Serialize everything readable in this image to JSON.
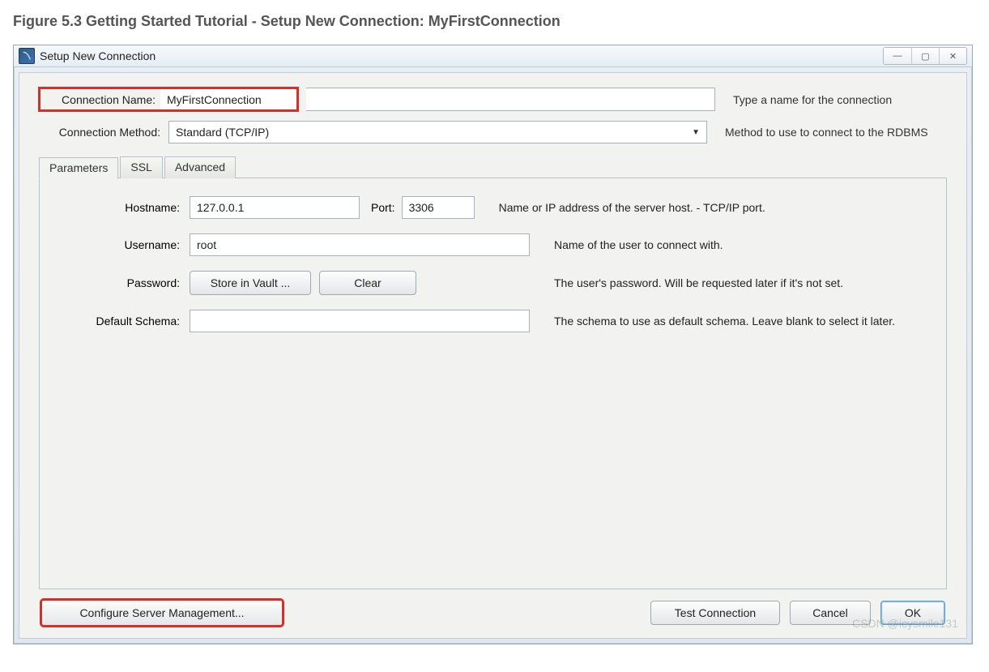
{
  "figure_title": "Figure 5.3 Getting Started Tutorial - Setup New Connection: MyFirstConnection",
  "window": {
    "title": "Setup New Connection",
    "minimize": "—",
    "maximize": "▢",
    "close": "✕"
  },
  "form": {
    "connection_name_label": "Connection Name:",
    "connection_name_value": "MyFirstConnection",
    "connection_name_help": "Type a name for the connection",
    "connection_method_label": "Connection Method:",
    "connection_method_value": "Standard (TCP/IP)",
    "connection_method_help": "Method to use to connect to the RDBMS"
  },
  "tabs": {
    "parameters": "Parameters",
    "ssl": "SSL",
    "advanced": "Advanced"
  },
  "params": {
    "hostname_label": "Hostname:",
    "hostname_value": "127.0.0.1",
    "port_label": "Port:",
    "port_value": "3306",
    "hostname_help": "Name or IP address of the server host. - TCP/IP port.",
    "username_label": "Username:",
    "username_value": "root",
    "username_help": "Name of the user to connect with.",
    "password_label": "Password:",
    "store_vault_btn": "Store in Vault ...",
    "clear_btn": "Clear",
    "password_help": "The user's password. Will be requested later if it's not set.",
    "default_schema_label": "Default Schema:",
    "default_schema_value": "",
    "default_schema_help": "The schema to use as default schema. Leave blank to select it later."
  },
  "footer": {
    "configure_btn": "Configure Server Management...",
    "test_btn": "Test Connection",
    "cancel_btn": "Cancel",
    "ok_btn": "OK"
  },
  "watermark": "CSDN @icysmile131"
}
